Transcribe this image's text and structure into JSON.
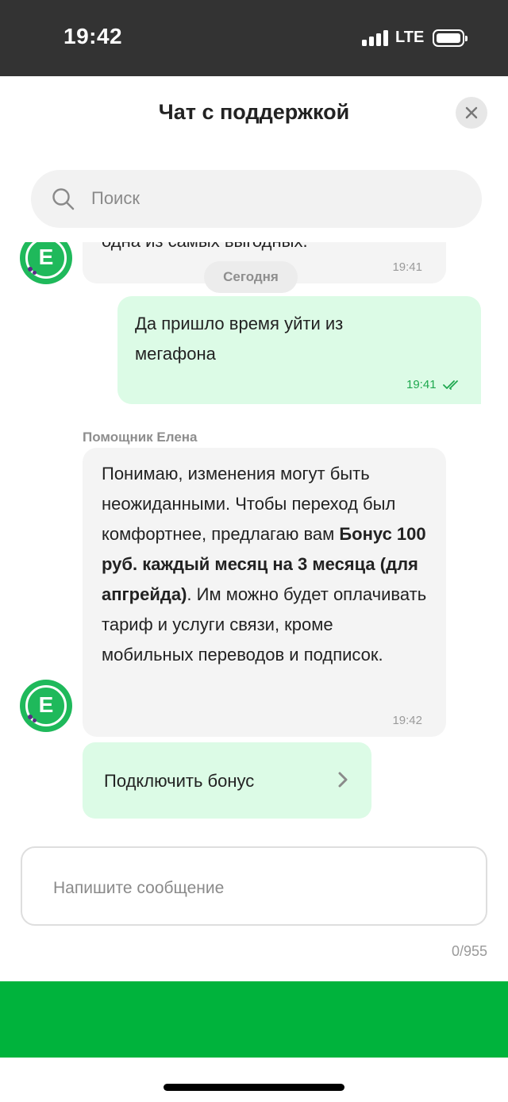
{
  "status": {
    "time": "19:42",
    "network": "LTE"
  },
  "header": {
    "title": "Чат с поддержкой"
  },
  "search": {
    "placeholder": "Поиск"
  },
  "chat": {
    "partial_message": {
      "text": "одна из самых выгодных.",
      "time": "19:41"
    },
    "date_separator": "Сегодня",
    "user_message": {
      "text": "Да пришло время уйти из мегафона",
      "time": "19:41",
      "status": "read"
    },
    "assistant": {
      "sender": "Помощник Елена",
      "avatar_letter": "E",
      "text_before": "Понимаю, изменения могут быть неожиданными. Чтобы переход был комфортнее, предлагаю вам ",
      "text_bold": "Бонус 100 руб. каждый месяц на 3 месяца (для апгрейда)",
      "text_after": ". Им можно будет оплачивать тариф и услуги связи, кроме мобильных переводов и подписок.",
      "time": "19:42"
    },
    "action_button": "Подключить бонус"
  },
  "composer": {
    "placeholder": "Напишите сообщение",
    "counter": "0/955"
  },
  "colors": {
    "brand_green": "#00b33c",
    "avatar_green": "#1fb95b",
    "outgoing_bubble": "#dcfbe6",
    "incoming_bubble": "#f4f4f4"
  },
  "icons": [
    "signal-icon",
    "battery-icon",
    "close-icon",
    "search-icon",
    "double-check-icon",
    "chevron-right-icon"
  ]
}
